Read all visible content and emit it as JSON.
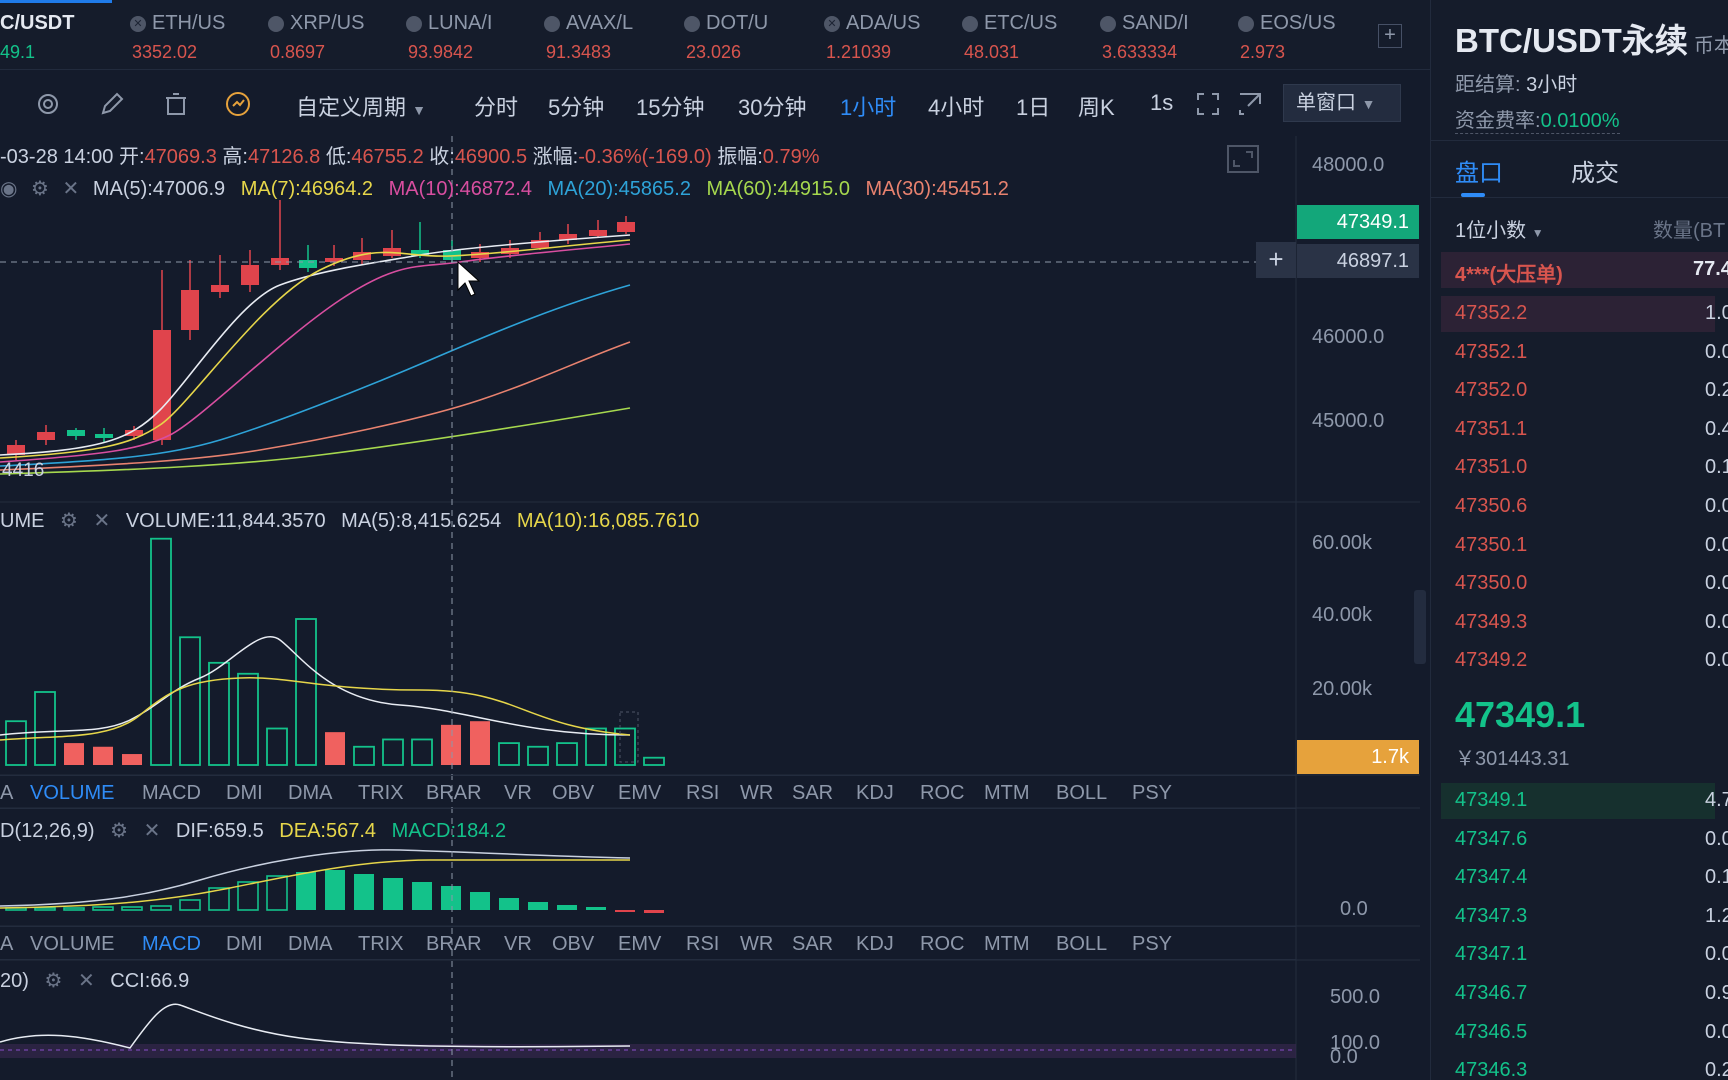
{
  "tickers": [
    {
      "name": "C/USDT",
      "price": "49.1",
      "active": true
    },
    {
      "name": "ETH/US",
      "price": "3352.02"
    },
    {
      "name": "XRP/US",
      "price": "0.8697"
    },
    {
      "name": "LUNA/I",
      "price": "93.9842"
    },
    {
      "name": "AVAX/L",
      "price": "91.3483"
    },
    {
      "name": "DOT/U",
      "price": "23.026"
    },
    {
      "name": "ADA/US",
      "price": "1.21039"
    },
    {
      "name": "ETC/US",
      "price": "48.031"
    },
    {
      "name": "SAND/I",
      "price": "3.633334"
    },
    {
      "name": "EOS/US",
      "price": "2.973"
    }
  ],
  "ticker_add": "+",
  "toolbar": {
    "custom_period": "自定义周期",
    "periods": [
      "分时",
      "5分钟",
      "15分钟",
      "30分钟",
      "1小时",
      "4小时",
      "1日",
      "周K",
      "1s"
    ],
    "active_period": "1小时",
    "window_mode": "单窗口"
  },
  "candle_info": {
    "date": "-03-28 14:00",
    "open_label": "开:",
    "open": "47069.3",
    "high_label": "高:",
    "high": "47126.8",
    "low_label": "低:",
    "low": "46755.2",
    "close_label": "收:",
    "close": "46900.5",
    "change_label": "涨幅:",
    "change": "-0.36%(-169.0)",
    "amp_label": "振幅:",
    "amp": "0.79%"
  },
  "ma_legend": [
    {
      "text": "MA(5):47006.9",
      "color": "#c9d1e0"
    },
    {
      "text": "MA(7):46964.2",
      "color": "#e6d64a"
    },
    {
      "text": "MA(10):46872.4",
      "color": "#d84ea0"
    },
    {
      "text": "MA(20):45865.2",
      "color": "#2ea3d8"
    },
    {
      "text": "MA(60):44915.0",
      "color": "#a6d84e"
    },
    {
      "text": "MA(30):45451.2",
      "color": "#e8826f"
    }
  ],
  "price_axis": [
    "48000.0",
    "46000.0",
    "45000.0"
  ],
  "last_price_tag": "47349.1",
  "cursor_price_tag": "46897.1",
  "low_marker": "4416",
  "volume": {
    "title": "UME",
    "values": [
      {
        "text": "VOLUME:11,844.3570",
        "color": "#c9d1e0"
      },
      {
        "text": "MA(5):8,415.6254",
        "color": "#c9d1e0"
      },
      {
        "text": "MA(10):16,085.7610",
        "color": "#e6d64a"
      }
    ],
    "axis": [
      "60.00k",
      "40.00k",
      "20.00k"
    ],
    "tag": "1.7k",
    "bars": [
      12,
      20,
      6,
      5,
      3,
      62,
      35,
      28,
      25,
      10,
      40,
      9,
      5,
      7,
      7,
      11,
      12,
      6,
      5,
      6,
      10,
      10,
      2
    ],
    "up": [
      true,
      true,
      false,
      false,
      false,
      true,
      true,
      true,
      true,
      true,
      true,
      false,
      true,
      true,
      true,
      false,
      false,
      true,
      true,
      true,
      true,
      true,
      true
    ]
  },
  "indicator_tabs": [
    "A",
    "VOLUME",
    "MACD",
    "DMI",
    "DMA",
    "TRIX",
    "BRAR",
    "VR",
    "OBV",
    "EMV",
    "RSI",
    "WR",
    "SAR",
    "KDJ",
    "ROC",
    "MTM",
    "BOLL",
    "PSY"
  ],
  "macd": {
    "title": "D(12,26,9)",
    "values": [
      {
        "text": "DIF:659.5",
        "color": "#c9d1e0"
      },
      {
        "text": "DEA:567.4",
        "color": "#e6d64a"
      },
      {
        "text": "MACD:184.2",
        "color": "#13c28a"
      }
    ],
    "axis": [
      "0.0"
    ]
  },
  "cci": {
    "title": "20)",
    "value": "CCI:66.9",
    "axis": [
      "500.0",
      "100.0",
      "0.0"
    ]
  },
  "right_panel": {
    "title": "BTC/USDT永续",
    "title_suffix": "币本",
    "settle_label": "距结算:",
    "settle_value": "3小时",
    "funding_label": "资金费率:",
    "funding_value": "0.0100%",
    "tabs": [
      "盘口",
      "成交"
    ],
    "precision": "1位小数",
    "qty_header": "数量(BT",
    "big_order_label": "4***(大压单)",
    "big_order_qty": "77.4",
    "asks": [
      {
        "price": "47352.2",
        "qty": "1.0"
      },
      {
        "price": "47352.1",
        "qty": "0.0"
      },
      {
        "price": "47352.0",
        "qty": "0.2"
      },
      {
        "price": "47351.1",
        "qty": "0.4"
      },
      {
        "price": "47351.0",
        "qty": "0.1"
      },
      {
        "price": "47350.6",
        "qty": "0.0"
      },
      {
        "price": "47350.1",
        "qty": "0.0"
      },
      {
        "price": "47350.0",
        "qty": "0.0"
      },
      {
        "price": "47349.3",
        "qty": "0.0"
      },
      {
        "price": "47349.2",
        "qty": "0.0"
      }
    ],
    "last_price": "47349.1",
    "last_price_cny": "￥301443.31",
    "bids": [
      {
        "price": "47349.1",
        "qty": "4.7"
      },
      {
        "price": "47347.6",
        "qty": "0.0"
      },
      {
        "price": "47347.4",
        "qty": "0.1"
      },
      {
        "price": "47347.3",
        "qty": "1.2"
      },
      {
        "price": "47347.1",
        "qty": "0.0"
      },
      {
        "price": "47346.7",
        "qty": "0.9"
      },
      {
        "price": "47346.5",
        "qty": "0.0"
      },
      {
        "price": "47346.3",
        "qty": "0.2"
      }
    ]
  }
}
